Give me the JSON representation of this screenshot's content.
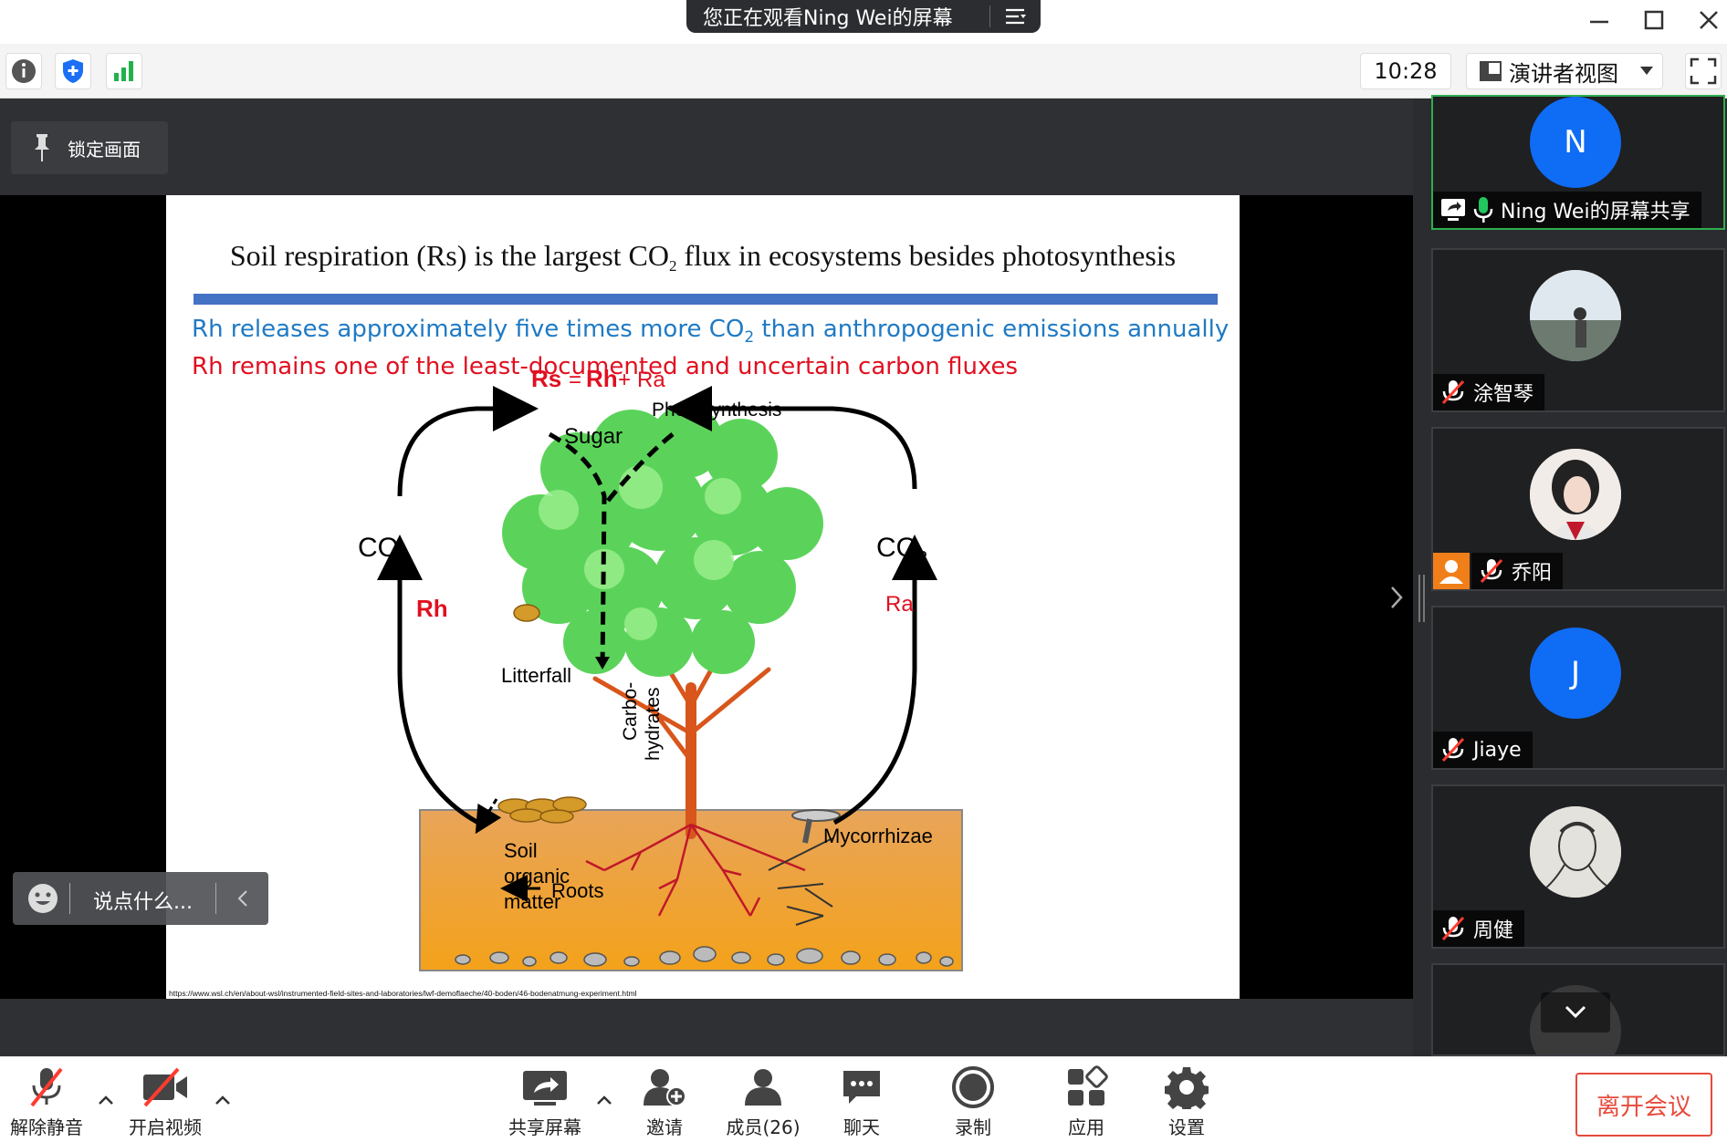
{
  "window": {
    "banner": "您正在观看Ning Wei的屏幕"
  },
  "toolbar": {
    "time": "10:28",
    "view_label": "演讲者视图"
  },
  "stage": {
    "lock_label": "锁定画面",
    "chat_placeholder": "说点什么..."
  },
  "slide": {
    "title_pre": "Soil respiration (Rs) is the largest CO",
    "title_sub": "2",
    "title_post": " flux in ecosystems besides photosynthesis",
    "line1_pre": "Rh releases approximately five times more CO",
    "line1_sub": "2",
    "line1_post": " than anthropogenic emissions annually",
    "line2": "Rh remains one of the least-documented and uncertain carbon fluxes",
    "eq_rs": "Rs",
    "eq_eq": "=",
    "eq_rh": "Rh",
    "eq_plus": "+",
    "eq_ra": "Ra",
    "photosynthesis": "Photosynthesis",
    "sugar": "Sugar",
    "co2_left": "CO",
    "co2_right": "CO",
    "co2_sub": "2",
    "rh": "Rh",
    "ra": "Ra",
    "litterfall": "Litterfall",
    "carbohydrates_1": "Carbo-",
    "carbohydrates_2": "hydrates",
    "mycorrhizae": "Mycorrhizae",
    "soil1": "Soil",
    "soil2": "organic",
    "soil3": "matter",
    "roots": "Roots",
    "url": "https://www.wsl.ch/en/about-wsl/instrumented-field-sites-and-laboratories/lwf-demoflaeche/40-boden/46-bodenatmung-experiment.html",
    "colors": {
      "blue_rule": "#4472c4",
      "blue_text": "#1f7ac4",
      "red_text": "#e01020"
    }
  },
  "participants": [
    {
      "initial": "N",
      "name": "Ning Wei的屏幕共享",
      "avatar_color": "#0f6cf5",
      "icon": "screen-share-icon"
    },
    {
      "initial": "",
      "name": "涂智琴",
      "avatar_color": "#c9d6de",
      "icon": "mic-muted-icon"
    },
    {
      "initial": "",
      "name": "乔阳",
      "avatar_color": "#e8e0dc",
      "icon": "mic-muted-icon"
    },
    {
      "initial": "J",
      "name": "Jiaye",
      "avatar_color": "#0f6cf5",
      "icon": "mic-muted-icon"
    },
    {
      "initial": "",
      "name": "周健",
      "avatar_color": "#d8d8d2",
      "icon": "mic-muted-icon"
    }
  ],
  "bottombar": {
    "unmute": "解除静音",
    "start_video": "开启视频",
    "share_screen": "共享屏幕",
    "invite": "邀请",
    "members": "成员(26)",
    "chat": "聊天",
    "record": "录制",
    "apps": "应用",
    "settings": "设置",
    "leave": "离开会议"
  }
}
